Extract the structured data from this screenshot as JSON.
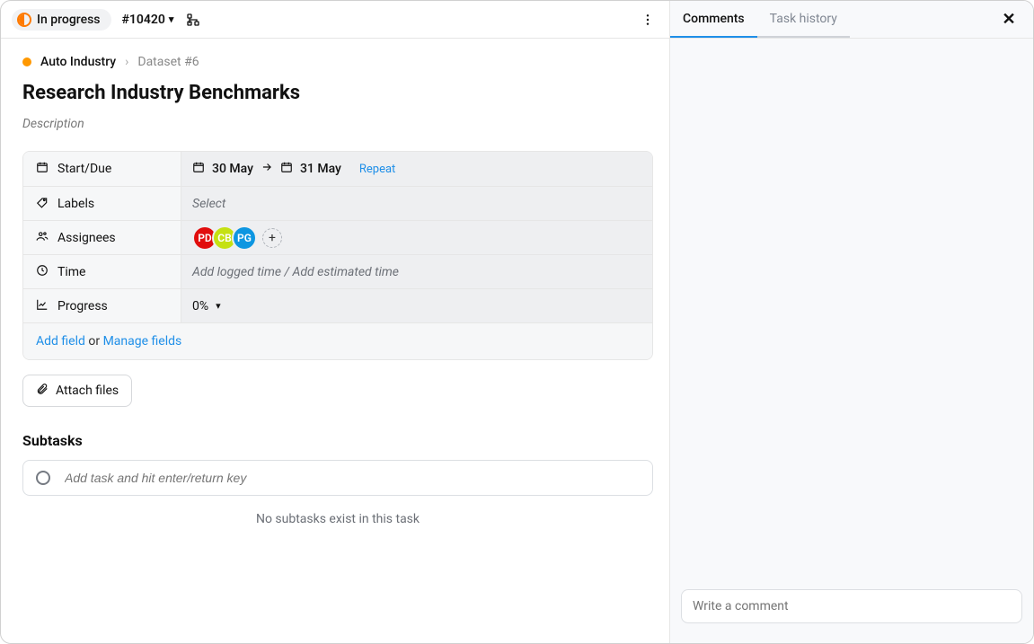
{
  "header": {
    "status_label": "In progress",
    "task_id_label": "#10420"
  },
  "breadcrumb": {
    "project": "Auto Industry",
    "item": "Dataset #6"
  },
  "task": {
    "title": "Research Industry Benchmarks",
    "description_placeholder": "Description"
  },
  "fields": {
    "start_due": {
      "label": "Start/Due",
      "start_text": "30 May",
      "end_text": "31 May",
      "repeat_link": "Repeat"
    },
    "labels": {
      "label": "Labels",
      "placeholder": "Select"
    },
    "assignees": {
      "label": "Assignees",
      "avatars": [
        {
          "initials": "PD",
          "color": "#e10d0d"
        },
        {
          "initials": "CB",
          "color": "#c5e112"
        },
        {
          "initials": "PG",
          "color": "#0d96e1"
        }
      ]
    },
    "time": {
      "label": "Time",
      "placeholder": "Add logged time / Add estimated time"
    },
    "progress": {
      "label": "Progress",
      "value_display": "0%"
    },
    "footer": {
      "add_field_link": "Add field",
      "or_text": " or ",
      "manage_fields_link": "Manage fields"
    }
  },
  "attach_button_label": "Attach files",
  "subtasks": {
    "heading": "Subtasks",
    "input_placeholder": "Add task and hit enter/return key",
    "empty_text": "No subtasks exist in this task"
  },
  "sidebar": {
    "tabs": {
      "comments_label": "Comments",
      "history_label": "Task history"
    },
    "comment_placeholder": "Write a comment"
  }
}
